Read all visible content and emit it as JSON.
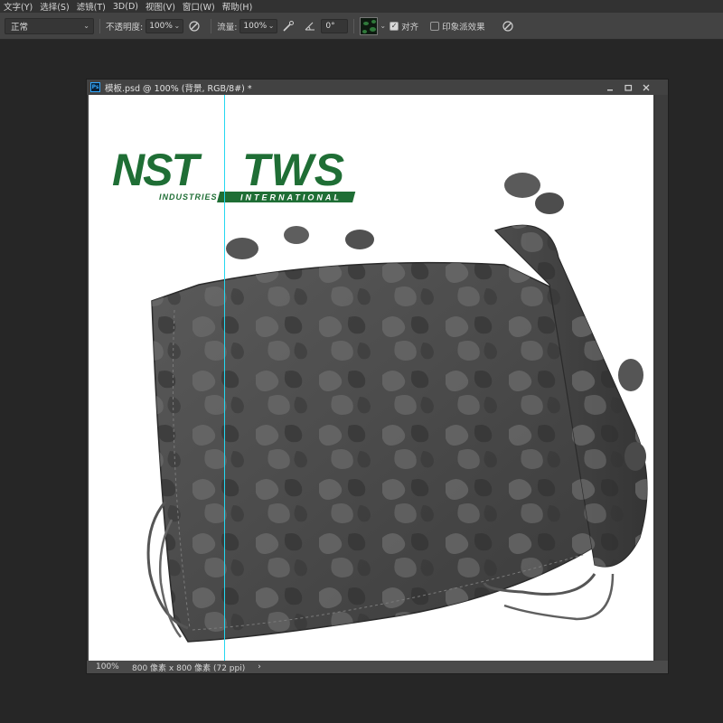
{
  "menu": [
    "文字(Y)",
    "选择(S)",
    "滤镜(T)",
    "3D(D)",
    "视图(V)",
    "窗口(W)",
    "帮助(H)"
  ],
  "options": {
    "blend_mode": "正常",
    "opacity_label": "不透明度:",
    "opacity_value": "100%",
    "flow_label": "流量:",
    "flow_value": "100%",
    "angle_value": "0°",
    "align_label": "对齐",
    "align_checked": true,
    "impressionist_label": "印象派效果",
    "impressionist_checked": false
  },
  "document": {
    "title": "模板.psd @ 100% (背景, RGB/8#) *",
    "zoom": "100%",
    "dimensions": "800 像素 x 800 像素 (72 ppi)",
    "status_arrow": "›"
  },
  "logo": {
    "brand_left": "NST",
    "brand_right": "TWS",
    "sub_left": "INDUSTRIES",
    "sub_right": "INTERNATIONAL",
    "color": "#1f6e35"
  },
  "colors": {
    "guide": "#24d8f0",
    "ps_accent": "#31a8ff"
  },
  "icons": [
    "airbrush-icon",
    "pressure-icon",
    "angle-icon",
    "pressure-size-icon",
    "chevron-down-icon",
    "minimize-icon",
    "maximize-icon",
    "close-icon"
  ]
}
